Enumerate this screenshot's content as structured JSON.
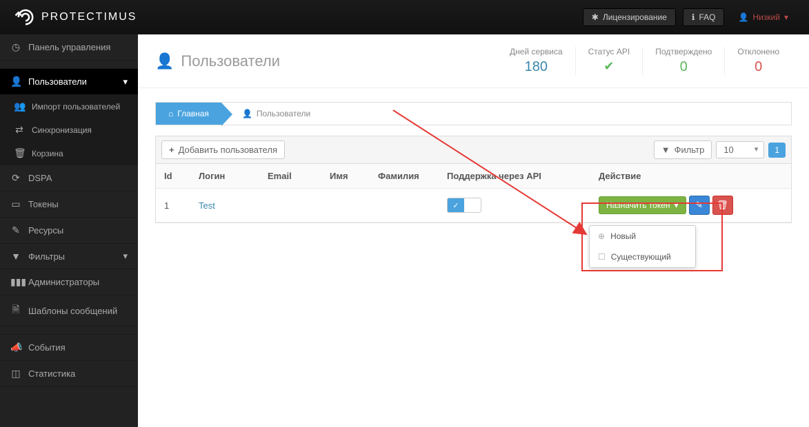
{
  "top": {
    "brand": "PROTECTIMUS",
    "licensing": "Лицензирование",
    "faq": "FAQ",
    "user": "Низкий"
  },
  "sidebar": {
    "dashboard": "Панель управления",
    "users": "Пользователи",
    "import": "Импорт пользователей",
    "sync": "Синхронизация",
    "bin": "Корзина",
    "dspa": "DSPA",
    "tokens": "Токены",
    "resources": "Ресурсы",
    "filters": "Фильтры",
    "admins": "Администраторы",
    "templates": "Шаблоны сообщений",
    "events": "События",
    "stats": "Статистика"
  },
  "page": {
    "title": "Пользователи",
    "stats": {
      "days_label": "Дней сервиса",
      "days_val": "180",
      "api_label": "Статус API",
      "confirmed_label": "Подтверждено",
      "confirmed_val": "0",
      "declined_label": "Отклонено",
      "declined_val": "0"
    }
  },
  "breadcrumb": {
    "home": "Главная",
    "current": "Пользователи"
  },
  "toolbar": {
    "add": "Добавить пользователя",
    "filter": "Фильтр",
    "pagesize": "10",
    "pagenum": "1"
  },
  "table": {
    "headers": {
      "id": "Id",
      "login": "Логин",
      "email": "Email",
      "first": "Имя",
      "last": "Фамилия",
      "api": "Поддержка через API",
      "action": "Действие"
    },
    "rows": [
      {
        "id": "1",
        "login": "Test",
        "email": "",
        "first": "",
        "last": ""
      }
    ]
  },
  "actions": {
    "assign": "Назначить токен"
  },
  "dropdown": {
    "new": "Новый",
    "existing": "Существующий"
  }
}
